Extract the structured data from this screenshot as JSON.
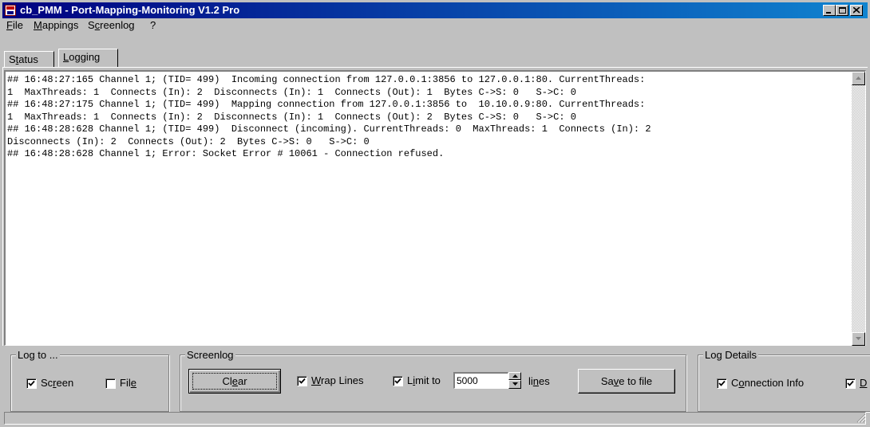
{
  "window": {
    "title": "cb_PMM - Port-Mapping-Monitoring V1.2 Pro"
  },
  "menu": [
    {
      "pre": "",
      "key": "F",
      "post": "ile"
    },
    {
      "pre": "",
      "key": "M",
      "post": "appings"
    },
    {
      "pre": "S",
      "key": "c",
      "post": "reenlog"
    },
    {
      "pre": "?",
      "key": "",
      "post": ""
    }
  ],
  "tabs": {
    "status": {
      "pre": "S",
      "key": "t",
      "post": "atus"
    },
    "logging": {
      "pre": "",
      "key": "L",
      "post": "ogging"
    },
    "active": "logging"
  },
  "log_lines": [
    "## 16:48:27:165 Channel 1; (TID= 499)  Incoming connection from 127.0.0.1:3856 to 127.0.0.1:80. CurrentThreads:",
    "1  MaxThreads: 1  Connects (In): 2  Disconnects (In): 1  Connects (Out): 1  Bytes C->S: 0   S->C: 0",
    "## 16:48:27:175 Channel 1; (TID= 499)  Mapping connection from 127.0.0.1:3856 to  10.10.0.9:80. CurrentThreads:",
    "1  MaxThreads: 1  Connects (In): 2  Disconnects (In): 1  Connects (Out): 2  Bytes C->S: 0   S->C: 0",
    "## 16:48:28:628 Channel 1; (TID= 499)  Disconnect (incoming). CurrentThreads: 0  MaxThreads: 1  Connects (In): 2",
    "Disconnects (In): 2  Connects (Out): 2  Bytes C->S: 0   S->C: 0",
    "## 16:48:28:628 Channel 1; Error: Socket Error # 10061 - Connection refused."
  ],
  "log_to": {
    "legend": "Log to ...",
    "screen": {
      "pre": "Sc",
      "key": "r",
      "post": "een",
      "checked": true
    },
    "file": {
      "pre": "Fil",
      "key": "e",
      "post": "",
      "checked": false
    }
  },
  "screenlog": {
    "legend": "Screenlog",
    "clear": {
      "pre": "Cl",
      "key": "e",
      "post": "ar"
    },
    "wrap": {
      "pre": "",
      "key": "W",
      "post": "rap Lines",
      "checked": true
    },
    "limit": {
      "pre": "L",
      "key": "i",
      "post": "mit to",
      "checked": true
    },
    "limit_value": "5000",
    "lines": {
      "pre": "li",
      "key": "n",
      "post": "es"
    },
    "save": {
      "pre": "Sa",
      "key": "v",
      "post": "e to file"
    }
  },
  "log_details": {
    "legend": "Log Details",
    "connection_info": {
      "pre": "C",
      "key": "o",
      "post": "nnection Info",
      "checked": true
    },
    "second": {
      "pre": "",
      "key": "D",
      "post": "",
      "checked": true
    }
  }
}
